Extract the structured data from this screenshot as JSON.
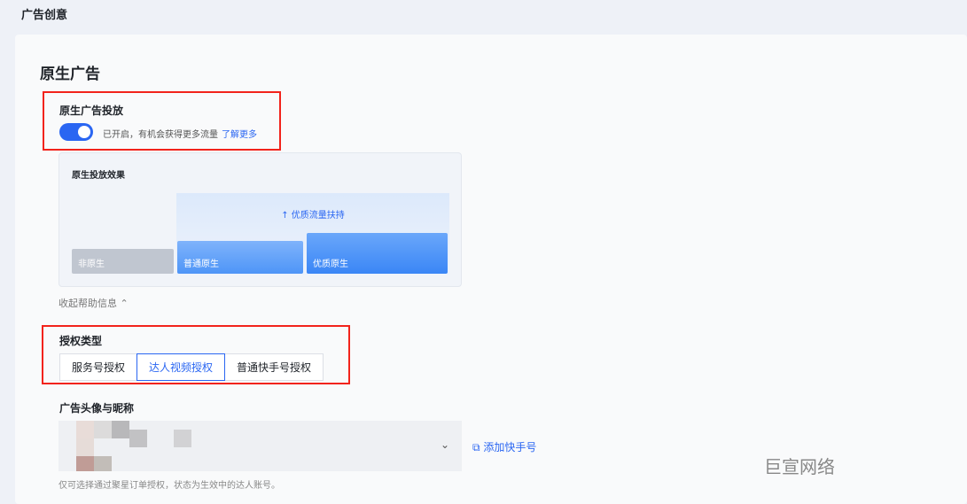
{
  "page_title": "广告创意",
  "section_title": "原生广告",
  "native": {
    "label": "原生广告投放",
    "toggle_on": true,
    "hint": "已开启，有机会获得更多流量",
    "link": "了解更多"
  },
  "effect": {
    "title": "原生投放效果",
    "boost": "↑ 优质流量扶持",
    "bars": [
      "非原生",
      "普通原生",
      "优质原生"
    ]
  },
  "collapse": "收起帮助信息 ⌃",
  "auth": {
    "label": "授权类型",
    "options": [
      "服务号授权",
      "达人视频授权",
      "普通快手号授权"
    ],
    "selected": "达人视频授权"
  },
  "avatar": {
    "label": "广告头像与昵称",
    "add": "添加快手号",
    "note": "仅可选择通过聚星订单授权，状态为生效中的达人账号。"
  },
  "watermark": "巨宣网络",
  "colors": {
    "accent": "#2a66f2",
    "highlight": "#f2231b"
  }
}
